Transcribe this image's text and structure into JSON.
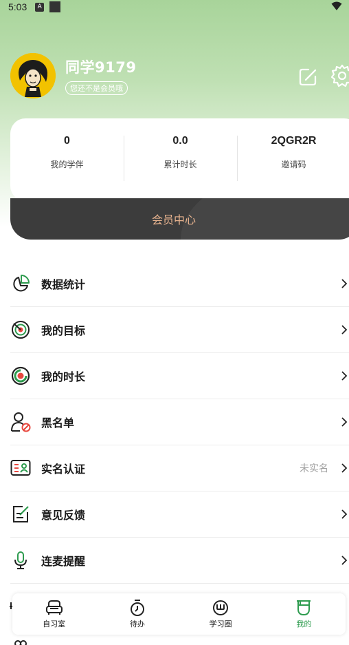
{
  "status_bar": {
    "time": "5:03",
    "notif_icon": "A"
  },
  "profile": {
    "username": "同学9179",
    "vip_status": "您还不是会员哦"
  },
  "stats": [
    {
      "value": "0",
      "label": "我的学伴"
    },
    {
      "value": "0.0",
      "label": "累计时长"
    },
    {
      "value": "2QGR2R",
      "label": "邀请码"
    }
  ],
  "vip_center": {
    "label": "会员中心"
  },
  "menu": [
    {
      "label": "数据统计",
      "icon": "pie-chart-icon",
      "extra": ""
    },
    {
      "label": "我的目标",
      "icon": "target-icon",
      "extra": ""
    },
    {
      "label": "我的时长",
      "icon": "duration-icon",
      "extra": ""
    },
    {
      "label": "黑名单",
      "icon": "blocked-user-icon",
      "extra": ""
    },
    {
      "label": "实名认证",
      "icon": "id-card-icon",
      "extra": "未实名"
    },
    {
      "label": "意见反馈",
      "icon": "feedback-icon",
      "extra": ""
    },
    {
      "label": "连麦提醒",
      "icon": "microphone-icon",
      "extra": ""
    }
  ],
  "bottom_nav": [
    {
      "label": "自习室",
      "icon": "armchair-icon",
      "active": false
    },
    {
      "label": "待办",
      "icon": "timer-icon",
      "active": false
    },
    {
      "label": "学习圈",
      "icon": "study-circle-icon",
      "active": false
    },
    {
      "label": "我的",
      "icon": "cup-icon",
      "active": true
    }
  ],
  "colors": {
    "accent_green": "#2d9b4e",
    "header_green": "#a8d49a",
    "vip_dark": "#3c3c3c",
    "vip_text": "#e9b48f",
    "target_red": "#e8483f"
  }
}
